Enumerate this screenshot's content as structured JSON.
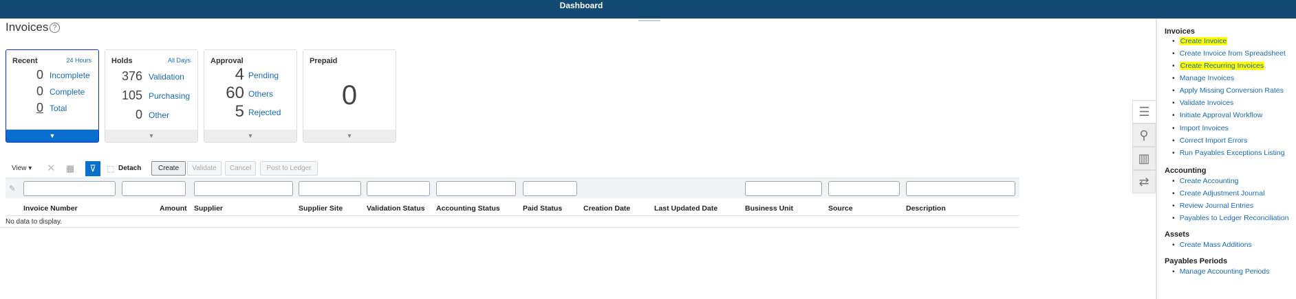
{
  "header": {
    "title": "Dashboard"
  },
  "page": {
    "title": "Invoices",
    "help_icon": "?"
  },
  "cards": {
    "recent": {
      "title": "Recent",
      "range": "24 Hours",
      "rows": [
        {
          "count": "0",
          "label": "Incomplete"
        },
        {
          "count": "0",
          "label": "Complete"
        },
        {
          "count": "0",
          "label": "Total"
        }
      ]
    },
    "holds": {
      "title": "Holds",
      "range": "All Days",
      "rows": [
        {
          "count": "376",
          "label": "Validation"
        },
        {
          "count": "105",
          "label": "Purchasing"
        },
        {
          "count": "0",
          "label": "Other"
        }
      ]
    },
    "approval": {
      "title": "Approval",
      "rows": [
        {
          "count": "4",
          "label": "Pending"
        },
        {
          "count": "60",
          "label": "Others"
        },
        {
          "count": "5",
          "label": "Rejected"
        }
      ]
    },
    "prepaid": {
      "title": "Prepaid",
      "count": "0"
    }
  },
  "toolbar": {
    "view": "View ▾",
    "detach": "Detach",
    "create": "Create",
    "validate": "Validate",
    "cancel": "Cancel",
    "post": "Post to Ledger"
  },
  "table": {
    "columns": [
      "Invoice Number",
      "Amount",
      "Supplier",
      "Supplier Site",
      "Validation Status",
      "Accounting Status",
      "Paid Status",
      "Creation Date",
      "Last Updated Date",
      "Business Unit",
      "Source",
      "Description"
    ],
    "empty": "No data to display."
  },
  "tasks": {
    "invoices": {
      "heading": "Invoices",
      "items": [
        "Create Invoice",
        "Create Invoice from Spreadsheet",
        "Create Recurring Invoices",
        "Manage Invoices",
        "Apply Missing Conversion Rates",
        "Validate Invoices",
        "Initiate Approval Workflow",
        "Import Invoices",
        "Correct Import Errors",
        "Run Payables Exceptions Listing"
      ]
    },
    "accounting": {
      "heading": "Accounting",
      "items": [
        "Create Accounting",
        "Create Adjustment Journal",
        "Review Journal Entries",
        "Payables to Ledger Reconciliation"
      ]
    },
    "assets": {
      "heading": "Assets",
      "items": [
        "Create Mass Additions"
      ]
    },
    "periods": {
      "heading": "Payables Periods",
      "items": [
        "Manage Accounting Periods"
      ]
    }
  },
  "colors": {
    "header": "#124a73",
    "link": "#1a6bb0",
    "highlight": "#ffff00",
    "selected": "#0a6fcc"
  }
}
